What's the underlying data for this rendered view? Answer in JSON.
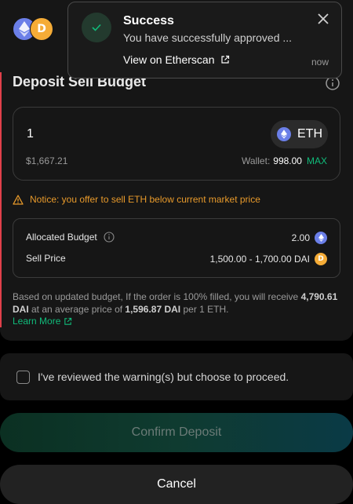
{
  "header": {
    "title": "Deposit Sell Budget",
    "icons": [
      "eth-icon",
      "dai-icon",
      "info-icon"
    ]
  },
  "deposit": {
    "amount": "1",
    "token": "ETH",
    "fiat_value": "$1,667.21",
    "wallet_label": "Wallet:",
    "wallet_balance": "998.00",
    "max_label": "MAX"
  },
  "notice": {
    "text": "Notice: you offer to sell ETH below current market price"
  },
  "budget": {
    "allocated_label": "Allocated Budget",
    "allocated_value": "2.00",
    "sell_price_label": "Sell Price",
    "sell_price_value": "1,500.00 - 1,700.00 DAI"
  },
  "summary": {
    "text_1": "Based on updated budget, If the order is 100% filled, you will receive ",
    "receive_amount": "4,790.61 DAI",
    "text_2": " at an average price of ",
    "avg_price": "1,596.87 DAI",
    "text_3": " per 1 ETH.",
    "learn_more": "Learn More"
  },
  "toast": {
    "title": "Success",
    "message": "You have successfully approved ...",
    "link": "View on Etherscan",
    "time": "now"
  },
  "acknowledge": {
    "label": "I've reviewed the warning(s) but choose to proceed."
  },
  "buttons": {
    "confirm": "Confirm Deposit",
    "cancel": "Cancel"
  },
  "colors": {
    "accent_green": "#10bb7a",
    "warning_orange": "#e89a2b",
    "danger_red": "#e0404a",
    "eth_blue": "#6b7fe8",
    "dai_gold": "#f5ac37"
  }
}
